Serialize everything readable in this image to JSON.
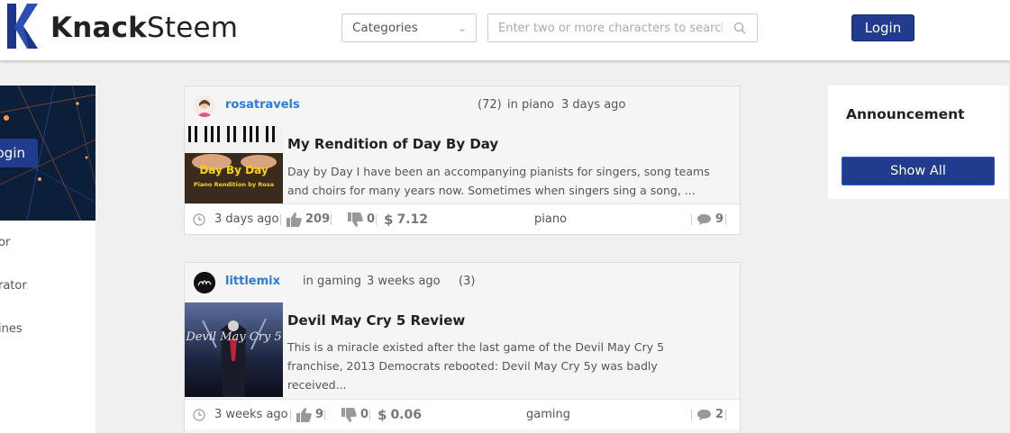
{
  "brand": {
    "name_bold": "Knack",
    "name_light": "Steem",
    "color": "#213b8f"
  },
  "header": {
    "categories_label": "Categories",
    "search_placeholder": "Enter two or more characters to search",
    "login_label": "Login"
  },
  "sidebar": {
    "banner_login_label": "Login",
    "items": [
      {
        "label": "or"
      },
      {
        "label": "rator"
      },
      {
        "label": "ines"
      }
    ]
  },
  "posts": [
    {
      "author": "rosatravels",
      "reputation": "(72)",
      "category_text": "in piano",
      "time_ago": "3 days ago",
      "title": "My Rendition of Day By Day",
      "excerpt": "Day by Day I have been an accompanying pianists for singers, song teams and choirs for many years now. Sometimes when singers sing a song, ...",
      "thumb_line1": "Day By Day",
      "thumb_line2": "Piano Rendition by Rosa",
      "footer_time": "3 days ago",
      "upvotes": "209",
      "downvotes": "0",
      "payout": "7.12",
      "tag": "piano",
      "comments": "9"
    },
    {
      "author": "littlemix",
      "reputation": "(3)",
      "category_text": "in gaming",
      "time_ago": "3 weeks ago",
      "title": "Devil May Cry 5 Review",
      "excerpt": "This is a miracle existed after the last game of the Devil May Cry 5 franchise, 2013 Democrats rebooted: Devil May Cry 5y was badly received...",
      "thumb_text": "Devil May Cry 5",
      "footer_time": "3 weeks ago",
      "upvotes": "9",
      "downvotes": "0",
      "payout": "0.06",
      "tag": "gaming",
      "comments": "2"
    }
  ],
  "announcement": {
    "title": "Announcement",
    "button_label": "Show All"
  },
  "icons": [
    "clock-icon",
    "thumbs-up-icon",
    "thumbs-down-icon",
    "dollar-icon",
    "comment-icon",
    "search-icon",
    "chevron-down-icon"
  ]
}
